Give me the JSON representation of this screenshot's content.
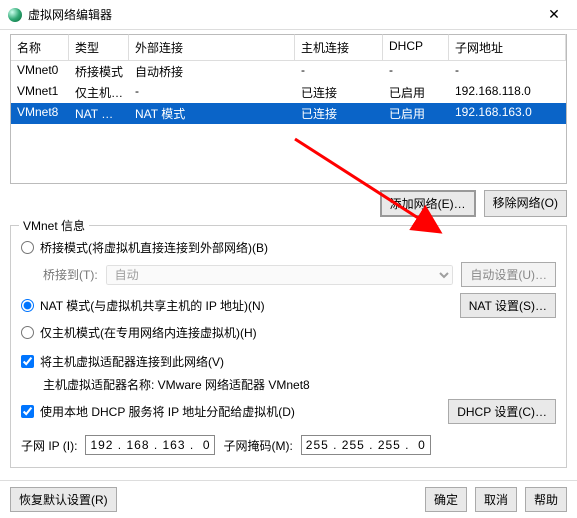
{
  "title": "虚拟网络编辑器",
  "columns": {
    "name": "名称",
    "type": "类型",
    "ext": "外部连接",
    "host": "主机连接",
    "dhcp": "DHCP",
    "subnet": "子网地址"
  },
  "rows": [
    {
      "name": "VMnet0",
      "type": "桥接模式",
      "ext": "自动桥接",
      "host": "-",
      "dhcp": "-",
      "subnet": "-"
    },
    {
      "name": "VMnet1",
      "type": "仅主机…",
      "ext": "-",
      "host": "已连接",
      "dhcp": "已启用",
      "subnet": "192.168.118.0"
    },
    {
      "name": "VMnet8",
      "type": "NAT 模式",
      "ext": "NAT 模式",
      "host": "已连接",
      "dhcp": "已启用",
      "subnet": "192.168.163.0"
    }
  ],
  "buttons": {
    "add_net": "添加网络(E)…",
    "remove_net": "移除网络(O)",
    "auto_set": "自动设置(U)…",
    "nat_set": "NAT 设置(S)…",
    "dhcp_set": "DHCP 设置(C)…",
    "restore": "恢复默认设置(R)",
    "ok": "确定",
    "cancel": "取消",
    "help": "帮助"
  },
  "group": {
    "title": "VMnet 信息",
    "bridge_opt": "桥接模式(将虚拟机直接连接到外部网络)(B)",
    "bridge_label": "桥接到(T):",
    "bridge_value": "自动",
    "nat_opt": "NAT 模式(与虚拟机共享主机的 IP 地址)(N)",
    "host_opt": "仅主机模式(在专用网络内连接虚拟机)(H)",
    "connect_host": "将主机虚拟适配器连接到此网络(V)",
    "adapter_label": "主机虚拟适配器名称: VMware 网络适配器 VMnet8",
    "dhcp_check": "使用本地 DHCP 服务将 IP 地址分配给虚拟机(D)",
    "subnet_ip_label": "子网 IP (I):",
    "subnet_ip": "192 . 168 . 163 .  0",
    "mask_label": "子网掩码(M):",
    "mask": "255 . 255 . 255 .  0"
  }
}
